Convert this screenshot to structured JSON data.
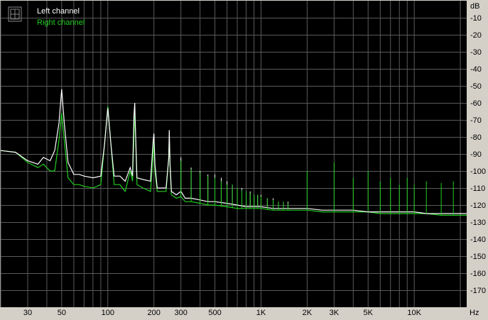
{
  "legend": {
    "entries": [
      {
        "label": "Left channel",
        "color": "#ffffff"
      },
      {
        "label": "Right channel",
        "color": "#22cc22"
      }
    ]
  },
  "colors": {
    "background": "#000000",
    "grid": "#5a5a5a",
    "frame": "#d4d0c8"
  },
  "chart_data": {
    "type": "line",
    "xscale": "log",
    "xlim": [
      20,
      22000
    ],
    "ylim": [
      -180,
      0
    ],
    "xunit": "Hz",
    "yunit": "dB",
    "grid": true,
    "legend_position": "top-left",
    "x_ticks": [
      {
        "value": 30,
        "label": "30"
      },
      {
        "value": 50,
        "label": "50"
      },
      {
        "value": 100,
        "label": "100"
      },
      {
        "value": 200,
        "label": "200"
      },
      {
        "value": 300,
        "label": "300"
      },
      {
        "value": 500,
        "label": "500"
      },
      {
        "value": 1000,
        "label": "1K"
      },
      {
        "value": 2000,
        "label": "2K"
      },
      {
        "value": 3000,
        "label": "3K"
      },
      {
        "value": 5000,
        "label": "5K"
      },
      {
        "value": 10000,
        "label": "10K"
      }
    ],
    "y_ticks": [
      -10,
      -20,
      -30,
      -40,
      -50,
      -60,
      -70,
      -80,
      -90,
      -100,
      -110,
      -120,
      -130,
      -140,
      -150,
      -160,
      -170
    ],
    "series": [
      {
        "name": "Left channel",
        "color": "#ffffff",
        "points": [
          [
            20,
            -88
          ],
          [
            25,
            -89
          ],
          [
            30,
            -94
          ],
          [
            35,
            -96
          ],
          [
            38,
            -92
          ],
          [
            42,
            -94
          ],
          [
            45,
            -88
          ],
          [
            48,
            -72
          ],
          [
            50,
            -52
          ],
          [
            52,
            -72
          ],
          [
            55,
            -95
          ],
          [
            60,
            -102
          ],
          [
            65,
            -102
          ],
          [
            70,
            -103
          ],
          [
            80,
            -104
          ],
          [
            90,
            -103
          ],
          [
            95,
            -85
          ],
          [
            100,
            -63
          ],
          [
            105,
            -85
          ],
          [
            110,
            -103
          ],
          [
            120,
            -103
          ],
          [
            130,
            -106
          ],
          [
            140,
            -98
          ],
          [
            145,
            -103
          ],
          [
            148,
            -68
          ],
          [
            150,
            -60
          ],
          [
            152,
            -80
          ],
          [
            155,
            -104
          ],
          [
            170,
            -105
          ],
          [
            190,
            -106
          ],
          [
            198,
            -82
          ],
          [
            200,
            -78
          ],
          [
            203,
            -96
          ],
          [
            210,
            -110
          ],
          [
            240,
            -110
          ],
          [
            250,
            -92
          ],
          [
            252,
            -76
          ],
          [
            255,
            -96
          ],
          [
            260,
            -112
          ],
          [
            280,
            -114
          ],
          [
            300,
            -112
          ],
          [
            320,
            -116
          ],
          [
            350,
            -116
          ],
          [
            400,
            -117
          ],
          [
            450,
            -118
          ],
          [
            500,
            -118
          ],
          [
            600,
            -119
          ],
          [
            700,
            -120
          ],
          [
            800,
            -121
          ],
          [
            1000,
            -121
          ],
          [
            1200,
            -122
          ],
          [
            1500,
            -122
          ],
          [
            2000,
            -122
          ],
          [
            2500,
            -123
          ],
          [
            3000,
            -123
          ],
          [
            4000,
            -123
          ],
          [
            5000,
            -124
          ],
          [
            6000,
            -124
          ],
          [
            8000,
            -124
          ],
          [
            10000,
            -124
          ],
          [
            12000,
            -125
          ],
          [
            15000,
            -125
          ],
          [
            18000,
            -125
          ],
          [
            20000,
            -125
          ],
          [
            22000,
            -125
          ]
        ]
      },
      {
        "name": "Right channel",
        "color": "#22cc22",
        "points": [
          [
            20,
            -88
          ],
          [
            25,
            -89
          ],
          [
            30,
            -95
          ],
          [
            35,
            -98
          ],
          [
            38,
            -96
          ],
          [
            42,
            -100
          ],
          [
            45,
            -100
          ],
          [
            48,
            -82
          ],
          [
            50,
            -66
          ],
          [
            52,
            -82
          ],
          [
            55,
            -104
          ],
          [
            60,
            -108
          ],
          [
            65,
            -108
          ],
          [
            70,
            -109
          ],
          [
            80,
            -110
          ],
          [
            90,
            -108
          ],
          [
            95,
            -85
          ],
          [
            100,
            -62
          ],
          [
            105,
            -85
          ],
          [
            110,
            -108
          ],
          [
            120,
            -108
          ],
          [
            130,
            -112
          ],
          [
            140,
            -100
          ],
          [
            145,
            -106
          ],
          [
            148,
            -80
          ],
          [
            150,
            -66
          ],
          [
            152,
            -82
          ],
          [
            155,
            -108
          ],
          [
            170,
            -110
          ],
          [
            190,
            -112
          ],
          [
            198,
            -90
          ],
          [
            200,
            -83
          ],
          [
            203,
            -100
          ],
          [
            210,
            -112
          ],
          [
            240,
            -112
          ],
          [
            250,
            -92
          ],
          [
            252,
            -80
          ],
          [
            255,
            -98
          ],
          [
            260,
            -114
          ],
          [
            280,
            -116
          ],
          [
            300,
            -115
          ],
          [
            320,
            -118
          ],
          [
            350,
            -118
          ],
          [
            400,
            -119
          ],
          [
            450,
            -120
          ],
          [
            500,
            -120
          ],
          [
            600,
            -121
          ],
          [
            700,
            -122
          ],
          [
            800,
            -122
          ],
          [
            1000,
            -122
          ],
          [
            1200,
            -123
          ],
          [
            1500,
            -123
          ],
          [
            2000,
            -123
          ],
          [
            2500,
            -124
          ],
          [
            3000,
            -124
          ],
          [
            4000,
            -124
          ],
          [
            5000,
            -124
          ],
          [
            6000,
            -125
          ],
          [
            8000,
            -125
          ],
          [
            10000,
            -125
          ],
          [
            12000,
            -125
          ],
          [
            15000,
            -126
          ],
          [
            18000,
            -126
          ],
          [
            20000,
            -126
          ],
          [
            22000,
            -126
          ]
        ]
      }
    ],
    "spurs": [
      {
        "series": "Left channel",
        "x": [
          300,
          350,
          400,
          450,
          500,
          550,
          600,
          650,
          700,
          750,
          800,
          850,
          900,
          950,
          1000,
          1100,
          1200,
          1300,
          1400,
          1500
        ],
        "y": [
          -92,
          -98,
          -100,
          -102,
          -102,
          -104,
          -106,
          -108,
          -110,
          -110,
          -112,
          -112,
          -114,
          -114,
          -114,
          -116,
          -116,
          -118,
          -118,
          -118
        ]
      },
      {
        "series": "Right channel",
        "x": [
          300,
          350,
          400,
          450,
          500,
          550,
          600,
          650,
          700,
          750,
          800,
          850,
          900,
          950,
          1000,
          1100,
          1200,
          1300,
          1400,
          1500,
          2000,
          3000,
          4000,
          5000,
          6000,
          7000,
          8000,
          9000,
          10000,
          12000,
          15000,
          18000
        ],
        "y": [
          -94,
          -99,
          -101,
          -103,
          -104,
          -106,
          -108,
          -108,
          -110,
          -111,
          -112,
          -113,
          -114,
          -114,
          -115,
          -116,
          -117,
          -118,
          -118,
          -119,
          -100,
          -95,
          -104,
          -100,
          -106,
          -104,
          -108,
          -104,
          -108,
          -106,
          -107,
          -106
        ]
      }
    ]
  }
}
